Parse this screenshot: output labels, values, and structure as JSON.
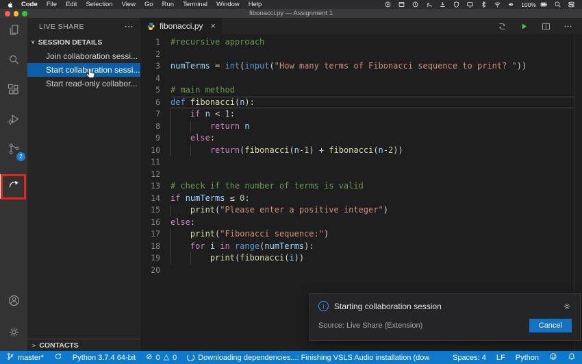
{
  "ui_glyphs": {
    "close": "×",
    "more": "⋯",
    "chevron_down": "∨",
    "chevron_right": ">",
    "error": "⊘",
    "warning": "△",
    "info": "i"
  },
  "menubar": {
    "items": [
      "Code",
      "File",
      "Edit",
      "Selection",
      "View",
      "Go",
      "Run",
      "Terminal",
      "Window",
      "Help"
    ],
    "status_icons": [
      "screen-recording-icon",
      "window-manager-icon",
      "clock-icon",
      "hand-icon",
      "download-icon",
      "shield-icon",
      "display-icon",
      "bluetooth-icon",
      "wifi-icon",
      "volume-icon",
      "battery-icon",
      "spotlight-icon",
      "control-center-icon"
    ],
    "battery_label": "100%"
  },
  "titlebar": {
    "title": "fibonacci.py — Assignment 1"
  },
  "activity_bar": {
    "top": [
      {
        "name": "explorer-icon"
      },
      {
        "name": "search-icon"
      },
      {
        "name": "extensions-icon"
      },
      {
        "name": "debug-icon"
      },
      {
        "name": "source-control-icon",
        "badge": "2"
      },
      {
        "name": "live-share-icon",
        "active": true
      }
    ],
    "bottom": [
      {
        "name": "account-icon"
      },
      {
        "name": "settings-gear-icon"
      }
    ]
  },
  "sidebar": {
    "header": "LIVE SHARE",
    "section": "SESSION DETAILS",
    "items": [
      {
        "label": "Join collaboration sessi...",
        "selected": false
      },
      {
        "label": "Start collaboration sessi...",
        "selected": true
      },
      {
        "label": "Start read-only collabor...",
        "selected": false
      }
    ],
    "contacts": "CONTACTS"
  },
  "editor": {
    "tab": {
      "name": "fibonacci.py"
    },
    "toolbar": [
      "compare-changes-icon",
      "run-icon",
      "split-editor-icon",
      "more-actions-icon"
    ],
    "code": {
      "lines": [
        {
          "n": 1,
          "indent": 0,
          "tokens": [
            [
              "#recursive approach",
              "comment"
            ]
          ]
        },
        {
          "n": 2,
          "indent": 0,
          "tokens": []
        },
        {
          "n": 3,
          "indent": 0,
          "tokens": [
            [
              "numTerms",
              "var"
            ],
            [
              " = ",
              "plain"
            ],
            [
              "int",
              "builtin"
            ],
            [
              "(",
              "plain"
            ],
            [
              "input",
              "builtin"
            ],
            [
              "(",
              "plain"
            ],
            [
              "\"How many terms of Fibonacci sequence to print? \"",
              "str"
            ],
            [
              "))",
              "plain"
            ]
          ]
        },
        {
          "n": 4,
          "indent": 0,
          "tokens": []
        },
        {
          "n": 5,
          "indent": 0,
          "tokens": [
            [
              "# main method",
              "comment"
            ]
          ]
        },
        {
          "n": 6,
          "indent": 0,
          "current": true,
          "tokens": [
            [
              "def",
              "kw2"
            ],
            [
              " ",
              "plain"
            ],
            [
              "fibonacci",
              "func"
            ],
            [
              "(",
              "plain"
            ],
            [
              "n",
              "var"
            ],
            [
              "):",
              "plain"
            ]
          ]
        },
        {
          "n": 7,
          "indent": 1,
          "tokens": [
            [
              "if",
              "kw"
            ],
            [
              " ",
              "plain"
            ],
            [
              "n",
              "var"
            ],
            [
              " < ",
              "plain"
            ],
            [
              "1",
              "num"
            ],
            [
              ":",
              "plain"
            ]
          ]
        },
        {
          "n": 8,
          "indent": 2,
          "tokens": [
            [
              "return",
              "kw"
            ],
            [
              " ",
              "plain"
            ],
            [
              "n",
              "var"
            ]
          ]
        },
        {
          "n": 9,
          "indent": 1,
          "tokens": [
            [
              "else",
              "kw"
            ],
            [
              ":",
              "plain"
            ]
          ]
        },
        {
          "n": 10,
          "indent": 2,
          "tokens": [
            [
              "return",
              "kw"
            ],
            [
              "(",
              "plain"
            ],
            [
              "fibonacci",
              "func"
            ],
            [
              "(",
              "plain"
            ],
            [
              "n",
              "var"
            ],
            [
              "-",
              "plain"
            ],
            [
              "1",
              "num"
            ],
            [
              ") + ",
              "plain"
            ],
            [
              "fibonacci",
              "func"
            ],
            [
              "(",
              "plain"
            ],
            [
              "n",
              "var"
            ],
            [
              "-",
              "plain"
            ],
            [
              "2",
              "num"
            ],
            [
              "))",
              "plain"
            ]
          ]
        },
        {
          "n": 11,
          "indent": 0,
          "tokens": []
        },
        {
          "n": 12,
          "indent": 0,
          "tokens": []
        },
        {
          "n": 13,
          "indent": 0,
          "tokens": [
            [
              "# check if the number of terms is valid",
              "comment"
            ]
          ]
        },
        {
          "n": 14,
          "indent": 0,
          "tokens": [
            [
              "if",
              "kw"
            ],
            [
              " ",
              "plain"
            ],
            [
              "numTerms",
              "var"
            ],
            [
              " ≤ ",
              "plain"
            ],
            [
              "0",
              "num"
            ],
            [
              ":",
              "plain"
            ]
          ]
        },
        {
          "n": 15,
          "indent": 1,
          "tokens": [
            [
              "print",
              "func"
            ],
            [
              "(",
              "plain"
            ],
            [
              "\"Please enter a positive integer\"",
              "str"
            ],
            [
              ")",
              "plain"
            ]
          ]
        },
        {
          "n": 16,
          "indent": 0,
          "tokens": [
            [
              "else",
              "kw"
            ],
            [
              ":",
              "plain"
            ]
          ]
        },
        {
          "n": 17,
          "indent": 1,
          "tokens": [
            [
              "print",
              "func"
            ],
            [
              "(",
              "plain"
            ],
            [
              "\"Fibonacci sequence:\"",
              "str"
            ],
            [
              ")",
              "plain"
            ]
          ]
        },
        {
          "n": 18,
          "indent": 1,
          "tokens": [
            [
              "for",
              "kw"
            ],
            [
              " ",
              "plain"
            ],
            [
              "i",
              "var"
            ],
            [
              " ",
              "plain"
            ],
            [
              "in",
              "kw"
            ],
            [
              " ",
              "plain"
            ],
            [
              "range",
              "builtin"
            ],
            [
              "(",
              "plain"
            ],
            [
              "numTerms",
              "var"
            ],
            [
              "):",
              "plain"
            ]
          ]
        },
        {
          "n": 19,
          "indent": 2,
          "tokens": [
            [
              "print",
              "func"
            ],
            [
              "(",
              "plain"
            ],
            [
              "fibonacci",
              "func"
            ],
            [
              "(",
              "plain"
            ],
            [
              "i",
              "var"
            ],
            [
              "))",
              "plain"
            ]
          ]
        },
        {
          "n": 20,
          "indent": 0,
          "tokens": []
        }
      ]
    }
  },
  "notification": {
    "title": "Starting collaboration session",
    "source": "Source: Live Share (Extension)",
    "cancel_label": "Cancel"
  },
  "statusbar": {
    "left": [
      {
        "name": "git-branch",
        "icon": "branch-icon",
        "text": "master*"
      },
      {
        "name": "sync",
        "icon": "sync-icon",
        "text": ""
      },
      {
        "name": "python-interpreter",
        "text": "Python 3.7.4 64-bit"
      },
      {
        "name": "problems",
        "icon": "error-icon",
        "text": "0",
        "icon2": "warning-icon",
        "text2": "0"
      },
      {
        "name": "task-progress",
        "icon": "spinner-icon",
        "text": "Downloading dependencies...: Finishing VSLS Audio installation (dow"
      }
    ],
    "right": [
      {
        "name": "indentation",
        "text": "Spaces: 4"
      },
      {
        "name": "eol",
        "text": "LF"
      },
      {
        "name": "language-mode",
        "text": "Python"
      },
      {
        "name": "feedback",
        "icon": "feedback-icon",
        "text": ""
      },
      {
        "name": "notifications-bell",
        "icon": "bell-icon",
        "text": ""
      }
    ]
  },
  "colors": {
    "statusbar_accent": "#0f79cc",
    "selection_blue": "#0c5fa6",
    "annotation_red": "#e1261d",
    "run_green": "#4fc154",
    "info_blue": "#3794ff",
    "badge_blue": "#1f7fd4"
  }
}
